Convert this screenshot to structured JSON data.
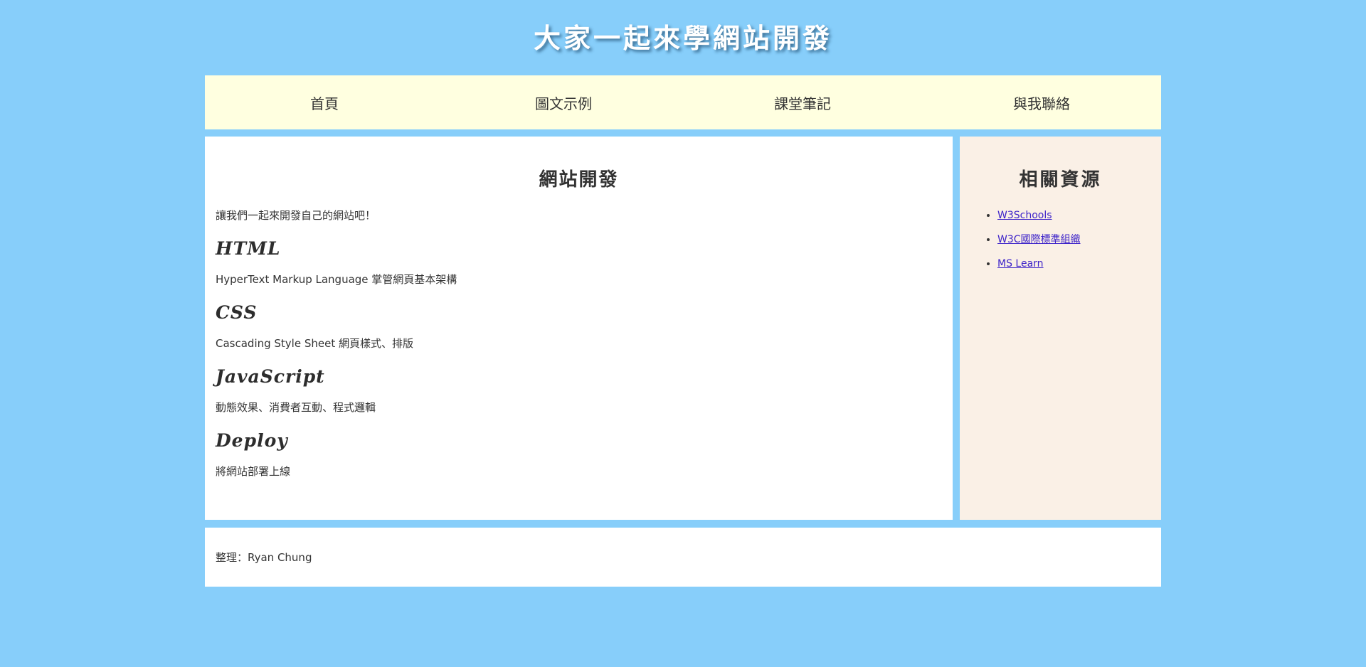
{
  "header": {
    "title": "大家一起來學網站開發"
  },
  "nav": {
    "items": [
      {
        "label": "首頁"
      },
      {
        "label": "圖文示例"
      },
      {
        "label": "課堂筆記"
      },
      {
        "label": "與我聯絡"
      }
    ]
  },
  "main": {
    "title": "網站開發",
    "intro": "讓我們一起來開發自己的網站吧！",
    "topics": [
      {
        "heading": "HTML",
        "description": "HyperText Markup Language 掌管網頁基本架構"
      },
      {
        "heading": "CSS",
        "description": "Cascading Style Sheet 網頁樣式、排版"
      },
      {
        "heading": "JavaScript",
        "description": "動態效果、消費者互動、程式邏輯"
      },
      {
        "heading": "Deploy",
        "description": "將網站部署上線"
      }
    ]
  },
  "aside": {
    "title": "相關資源",
    "links": [
      {
        "label": "W3Schools"
      },
      {
        "label": "W3C國際標準組織"
      },
      {
        "label": "MS Learn"
      }
    ]
  },
  "footer": {
    "text": "整理：Ryan Chung"
  },
  "colors": {
    "page_background": "#87cefa",
    "nav_background": "#ffffe0",
    "aside_background": "#faf0e6",
    "link": "#3d23c9"
  }
}
